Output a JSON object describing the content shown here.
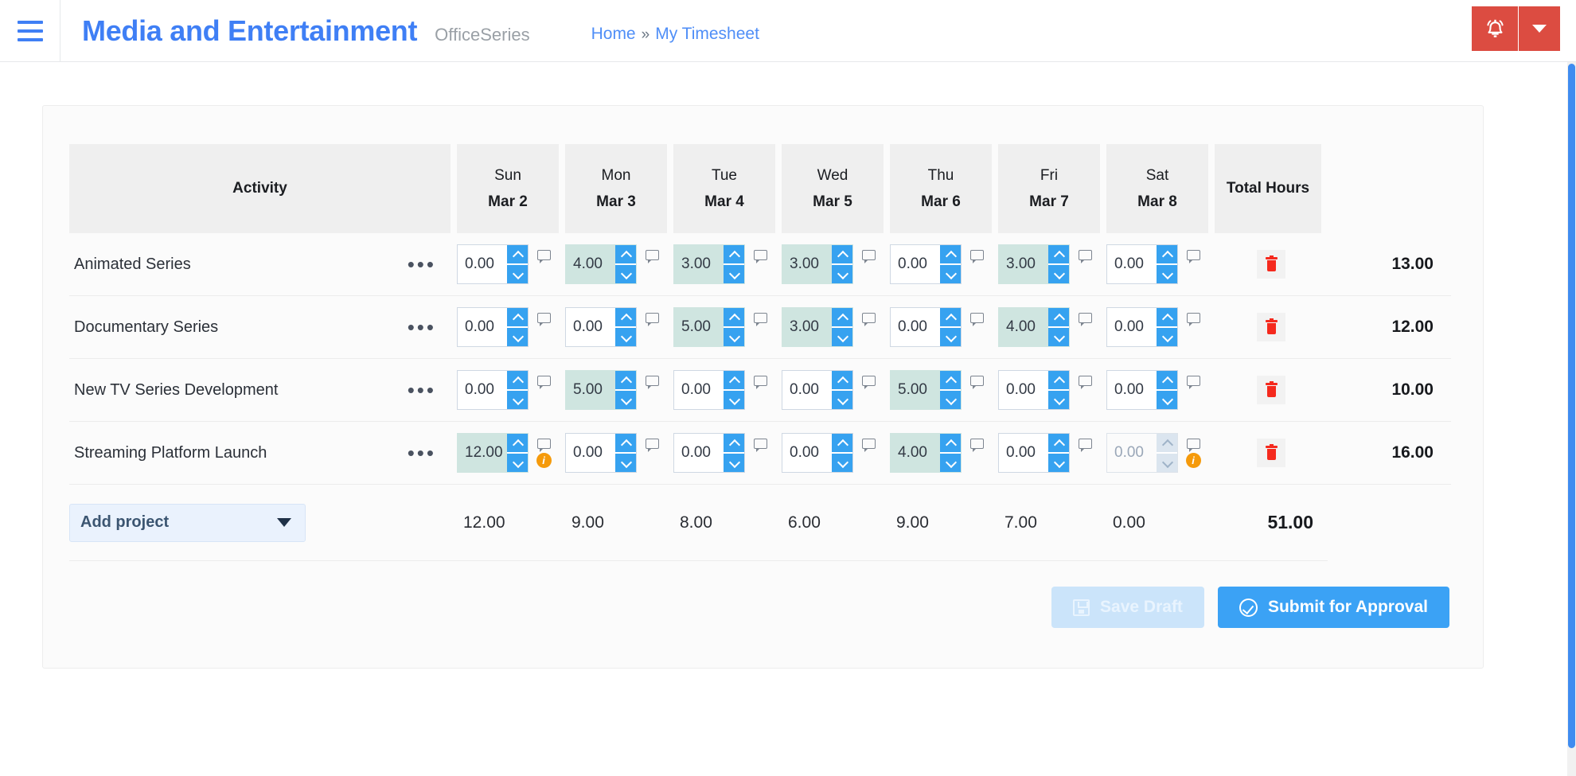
{
  "topbar": {
    "menu_icon": "hamburger-icon",
    "brand_title": "Media and Entertainment",
    "brand_subtitle": "OfficeSeries",
    "breadcrumb": {
      "home": "Home",
      "separator": "»",
      "current": "My Timesheet"
    },
    "alert_icon": "alarm-bell-icon",
    "alert_caret_icon": "chevron-down-icon",
    "alert_color": "#dc4c41",
    "brand_color": "#3f7ff5"
  },
  "table": {
    "headers": {
      "activity": "Activity",
      "days": [
        {
          "dow": "Sun",
          "date": "Mar 2"
        },
        {
          "dow": "Mon",
          "date": "Mar 3"
        },
        {
          "dow": "Tue",
          "date": "Mar 4"
        },
        {
          "dow": "Wed",
          "date": "Mar 5"
        },
        {
          "dow": "Thu",
          "date": "Mar 6"
        },
        {
          "dow": "Fri",
          "date": "Mar 7"
        },
        {
          "dow": "Sat",
          "date": "Mar 8"
        }
      ],
      "total": "Total Hours"
    },
    "rows": [
      {
        "activity": "Animated Series",
        "menu_icon": "ellipsis-icon",
        "delete_icon": "trash-icon",
        "cells": [
          {
            "value": "0.00",
            "filled": false,
            "info": false,
            "disabled": false
          },
          {
            "value": "4.00",
            "filled": true,
            "info": false,
            "disabled": false
          },
          {
            "value": "3.00",
            "filled": true,
            "info": false,
            "disabled": false
          },
          {
            "value": "3.00",
            "filled": true,
            "info": false,
            "disabled": false
          },
          {
            "value": "0.00",
            "filled": false,
            "info": false,
            "disabled": false
          },
          {
            "value": "3.00",
            "filled": true,
            "info": false,
            "disabled": false
          },
          {
            "value": "0.00",
            "filled": false,
            "info": false,
            "disabled": false
          }
        ],
        "total": "13.00"
      },
      {
        "activity": "Documentary Series",
        "menu_icon": "ellipsis-icon",
        "delete_icon": "trash-icon",
        "cells": [
          {
            "value": "0.00",
            "filled": false,
            "info": false,
            "disabled": false
          },
          {
            "value": "0.00",
            "filled": false,
            "info": false,
            "disabled": false
          },
          {
            "value": "5.00",
            "filled": true,
            "info": false,
            "disabled": false
          },
          {
            "value": "3.00",
            "filled": true,
            "info": false,
            "disabled": false
          },
          {
            "value": "0.00",
            "filled": false,
            "info": false,
            "disabled": false
          },
          {
            "value": "4.00",
            "filled": true,
            "info": false,
            "disabled": false
          },
          {
            "value": "0.00",
            "filled": false,
            "info": false,
            "disabled": false
          }
        ],
        "total": "12.00"
      },
      {
        "activity": "New TV Series Development",
        "menu_icon": "ellipsis-icon",
        "delete_icon": "trash-icon",
        "cells": [
          {
            "value": "0.00",
            "filled": false,
            "info": false,
            "disabled": false
          },
          {
            "value": "5.00",
            "filled": true,
            "info": false,
            "disabled": false
          },
          {
            "value": "0.00",
            "filled": false,
            "info": false,
            "disabled": false
          },
          {
            "value": "0.00",
            "filled": false,
            "info": false,
            "disabled": false
          },
          {
            "value": "5.00",
            "filled": true,
            "info": false,
            "disabled": false
          },
          {
            "value": "0.00",
            "filled": false,
            "info": false,
            "disabled": false
          },
          {
            "value": "0.00",
            "filled": false,
            "info": false,
            "disabled": false
          }
        ],
        "total": "10.00"
      },
      {
        "activity": "Streaming Platform Launch",
        "menu_icon": "ellipsis-icon",
        "delete_icon": "trash-icon",
        "cells": [
          {
            "value": "12.00",
            "filled": true,
            "info": true,
            "disabled": false
          },
          {
            "value": "0.00",
            "filled": false,
            "info": false,
            "disabled": false
          },
          {
            "value": "0.00",
            "filled": false,
            "info": false,
            "disabled": false
          },
          {
            "value": "0.00",
            "filled": false,
            "info": false,
            "disabled": false
          },
          {
            "value": "4.00",
            "filled": true,
            "info": false,
            "disabled": false
          },
          {
            "value": "0.00",
            "filled": false,
            "info": false,
            "disabled": false
          },
          {
            "value": "0.00",
            "filled": false,
            "info": true,
            "disabled": true
          }
        ],
        "total": "16.00"
      }
    ],
    "totals_row": {
      "add_project_label": "Add project",
      "add_project_caret": "chevron-down-icon",
      "day_totals": [
        "12.00",
        "9.00",
        "8.00",
        "6.00",
        "9.00",
        "7.00",
        "0.00"
      ],
      "grand_total": "51.00"
    }
  },
  "actions": {
    "save_draft_label": "Save Draft",
    "save_draft_icon": "save-disk-icon",
    "submit_label": "Submit for Approval",
    "submit_icon": "check-circle-icon",
    "submit_color": "#3ba2f5",
    "save_color": "#cbe4fa"
  }
}
